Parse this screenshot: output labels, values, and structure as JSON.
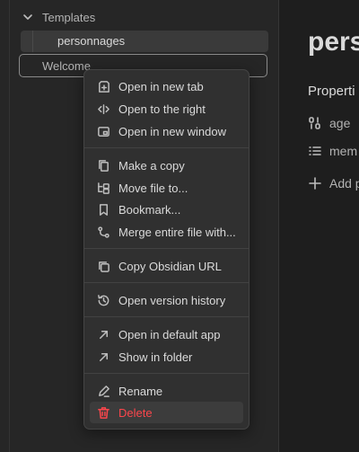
{
  "sidebar": {
    "folder": {
      "label": "Templates",
      "icon": "chevron-down-icon"
    },
    "files": [
      {
        "label": "personnages"
      },
      {
        "label": "Welcome"
      }
    ]
  },
  "note": {
    "title": "perso",
    "properties_heading": "Properti",
    "properties": [
      {
        "name": "age",
        "icon": "number-icon"
      },
      {
        "name": "mem",
        "icon": "list-icon"
      }
    ],
    "add_property": "Add p"
  },
  "context_menu": {
    "groups": [
      [
        {
          "label": "Open in new tab",
          "icon": "new-tab-icon"
        },
        {
          "label": "Open to the right",
          "icon": "split-right-icon"
        },
        {
          "label": "Open in new window",
          "icon": "new-window-icon"
        }
      ],
      [
        {
          "label": "Make a copy",
          "icon": "copy-file-icon"
        },
        {
          "label": "Move file to...",
          "icon": "move-folder-icon"
        },
        {
          "label": "Bookmark...",
          "icon": "bookmark-icon"
        },
        {
          "label": "Merge entire file with...",
          "icon": "merge-icon"
        }
      ],
      [
        {
          "label": "Copy Obsidian URL",
          "icon": "copy-icon"
        }
      ],
      [
        {
          "label": "Open version history",
          "icon": "history-icon"
        }
      ],
      [
        {
          "label": "Open in default app",
          "icon": "arrow-up-right-icon"
        },
        {
          "label": "Show in folder",
          "icon": "arrow-up-right-icon"
        }
      ],
      [
        {
          "label": "Rename",
          "icon": "pencil-icon"
        },
        {
          "label": "Delete",
          "icon": "trash-icon",
          "danger": true
        }
      ]
    ]
  },
  "colors": {
    "danger": "#fb464c",
    "menu_bg": "#303030",
    "sidebar_bg": "#262626",
    "editor_bg": "#1e1e1e"
  }
}
